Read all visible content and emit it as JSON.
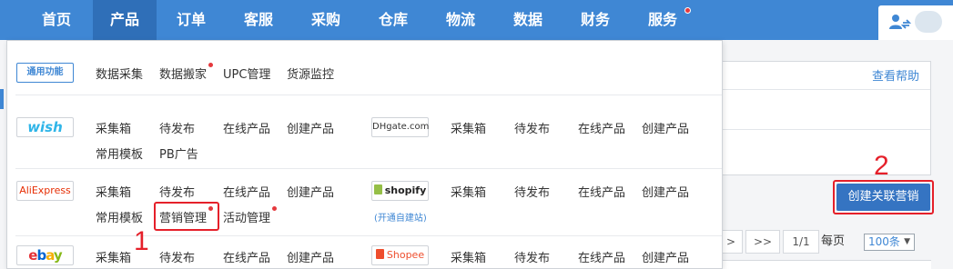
{
  "nav": {
    "items": [
      "首页",
      "产品",
      "订单",
      "客服",
      "采购",
      "仓库",
      "物流",
      "数据",
      "财务",
      "服务"
    ],
    "active": "产品"
  },
  "help_link": "查看帮助",
  "create_button": "创建关联营销",
  "annotations": {
    "one": "1",
    "two": "2"
  },
  "pager": {
    "next": ">",
    "last": ">>",
    "pages": "1/1",
    "per_page_label": "每页",
    "per_page_value": "100条"
  },
  "menu": {
    "common": {
      "logo": "通用功能",
      "links": [
        "数据采集",
        "数据搬家",
        "UPC管理",
        "货源监控"
      ]
    },
    "wish": {
      "logo": "wish",
      "links": [
        "采集箱",
        "待发布",
        "在线产品",
        "创建产品",
        "常用模板",
        "PB广告"
      ]
    },
    "dhgate": {
      "logo": "DHgate.com",
      "links": [
        "采集箱",
        "待发布",
        "在线产品",
        "创建产品"
      ]
    },
    "aliexpress": {
      "logo": "AliExpress",
      "links": [
        "采集箱",
        "待发布",
        "在线产品",
        "创建产品",
        "常用模板",
        "营销管理",
        "活动管理"
      ]
    },
    "shopify": {
      "logo": "shopify",
      "sub": "(开通自建站)",
      "links": [
        "采集箱",
        "待发布",
        "在线产品",
        "创建产品"
      ]
    },
    "ebay": {
      "logo_parts": [
        "e",
        "b",
        "a",
        "y"
      ],
      "links": [
        "采集箱",
        "待发布",
        "在线产品",
        "创建产品"
      ]
    },
    "shopee": {
      "logo": "Shopee",
      "links": [
        "采集箱",
        "待发布",
        "在线产品",
        "创建产品"
      ]
    }
  }
}
